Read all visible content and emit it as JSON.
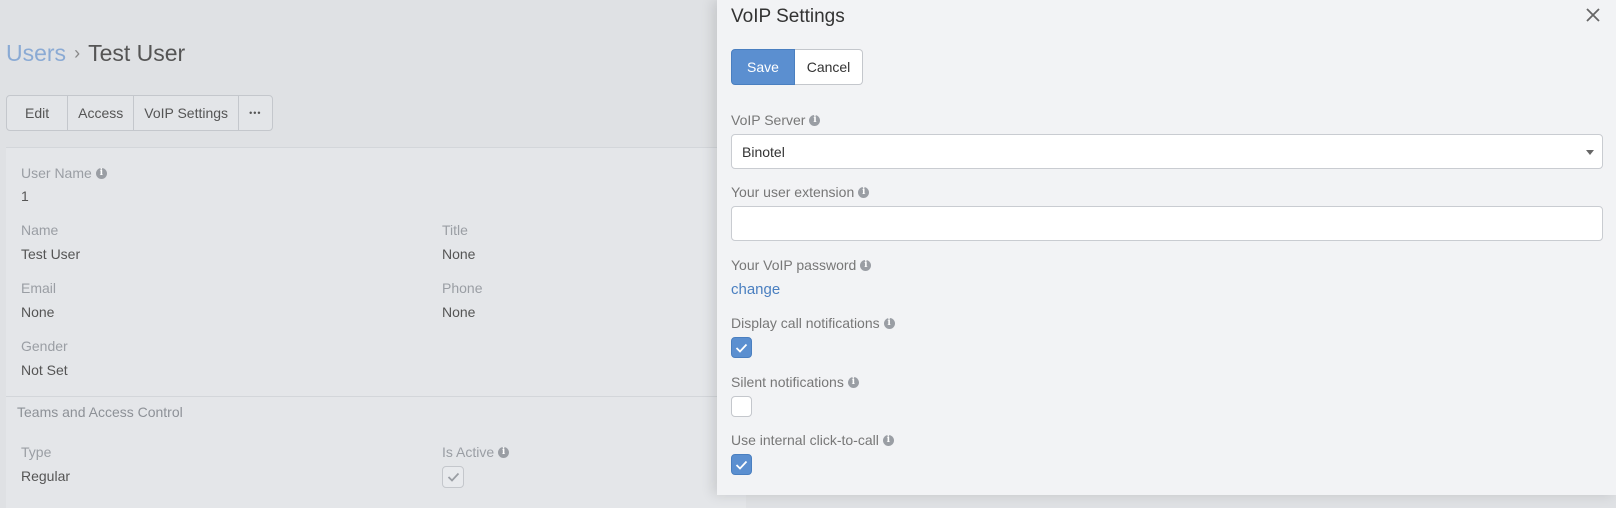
{
  "breadcrumb": {
    "parent": "Users",
    "current": "Test User"
  },
  "actions": {
    "edit": "Edit",
    "access": "Access",
    "voip": "VoIP Settings",
    "more": "•••"
  },
  "details": {
    "user_name_label": "User Name",
    "user_name_value": "1",
    "name_label": "Name",
    "name_value": "Test User",
    "title_label": "Title",
    "title_value": "None",
    "email_label": "Email",
    "email_value": "None",
    "phone_label": "Phone",
    "phone_value": "None",
    "gender_label": "Gender",
    "gender_value": "Not Set",
    "teams_section": "Teams and Access Control",
    "type_label": "Type",
    "type_value": "Regular",
    "is_active_label": "Is Active",
    "is_active_checked": true
  },
  "modal": {
    "title": "VoIP Settings",
    "save": "Save",
    "cancel": "Cancel",
    "voip_server_label": "VoIP Server",
    "voip_server_value": "Binotel",
    "extension_label": "Your user extension",
    "extension_value": "",
    "password_label": "Your VoIP password",
    "password_link": "change",
    "display_notifications_label": "Display call notifications",
    "display_notifications_checked": true,
    "silent_notifications_label": "Silent notifications",
    "silent_notifications_checked": false,
    "click_to_call_label": "Use internal click-to-call",
    "click_to_call_checked": true
  },
  "colors": {
    "accent": "#5b8fd0",
    "link": "#4a7fc0",
    "panel_bg": "#f2f3f5",
    "overlay_bg": "#dfe1e4"
  },
  "icons": {
    "info": "info-icon",
    "close": "close-icon",
    "check": "check-icon",
    "caret": "caret-down-icon"
  }
}
